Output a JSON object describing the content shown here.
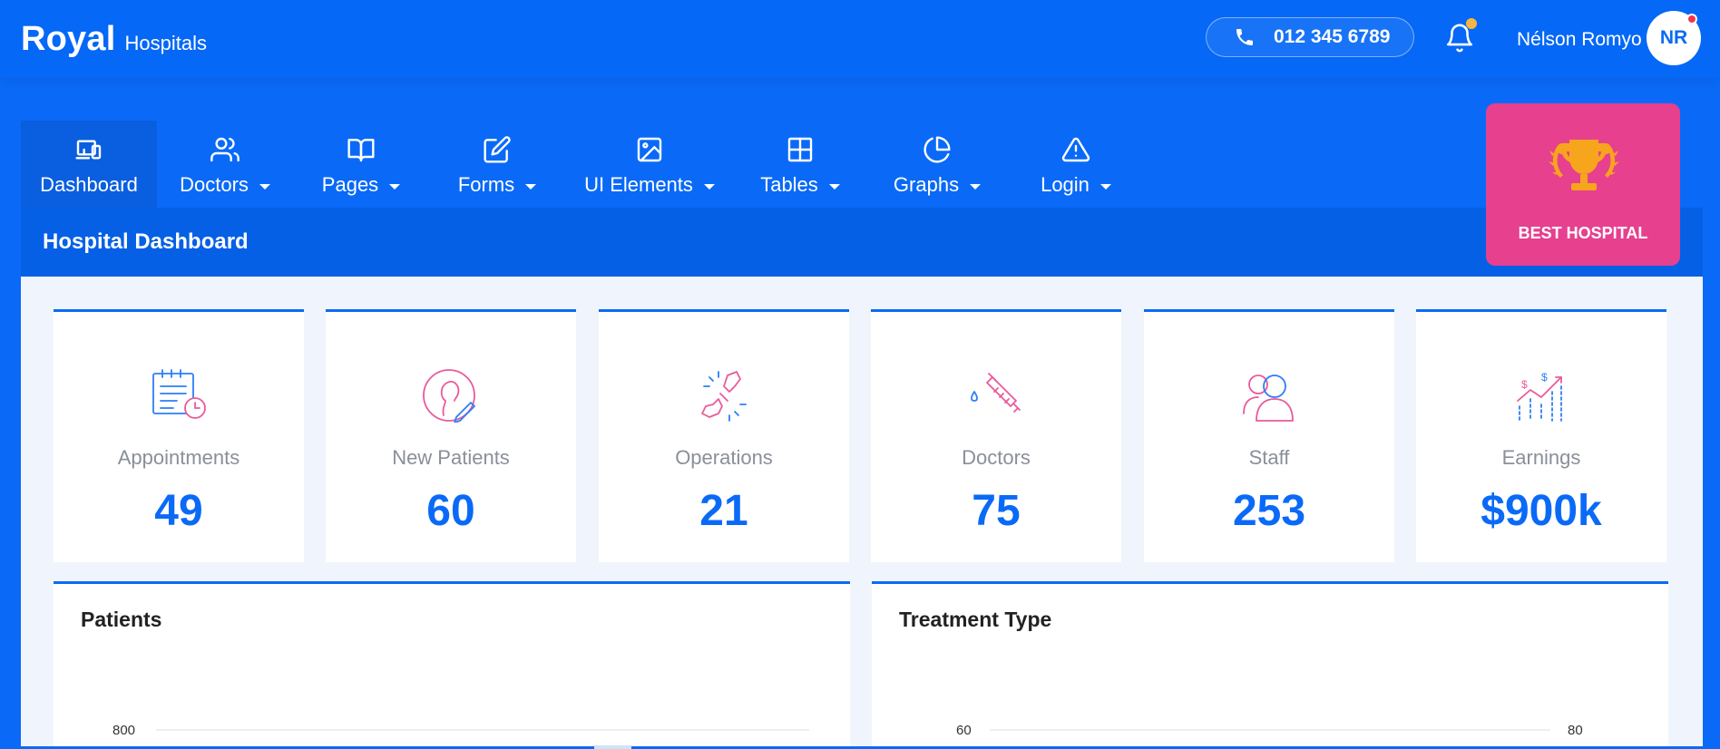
{
  "brand": {
    "name": "Royal",
    "suffix": "Hospitals"
  },
  "header": {
    "phone": "012 345 6789",
    "user_name": "Nélson Romyo",
    "avatar_initials": "NR"
  },
  "nav": [
    {
      "label": "Dashboard",
      "icon": "devices-icon",
      "active": true
    },
    {
      "label": "Doctors",
      "icon": "users-icon"
    },
    {
      "label": "Pages",
      "icon": "book-icon"
    },
    {
      "label": "Forms",
      "icon": "edit-icon"
    },
    {
      "label": "UI Elements",
      "icon": "image-icon"
    },
    {
      "label": "Tables",
      "icon": "grid-icon"
    },
    {
      "label": "Graphs",
      "icon": "pie-chart-icon"
    },
    {
      "label": "Login",
      "icon": "alert-triangle-icon"
    }
  ],
  "page_title": "Hospital Dashboard",
  "badge": {
    "label": "BEST HOSPITAL",
    "icon": "trophy-icon"
  },
  "stats": [
    {
      "label": "Appointments",
      "value": "49",
      "icon": "calendar-clock-icon"
    },
    {
      "label": "New Patients",
      "value": "60",
      "icon": "patient-icon"
    },
    {
      "label": "Operations",
      "value": "21",
      "icon": "bandage-icon"
    },
    {
      "label": "Doctors",
      "value": "75",
      "icon": "syringe-icon"
    },
    {
      "label": "Staff",
      "value": "253",
      "icon": "staff-icon"
    },
    {
      "label": "Earnings",
      "value": "$900k",
      "icon": "earnings-icon"
    }
  ],
  "charts": {
    "patients": {
      "title": "Patients",
      "tick_top": "800"
    },
    "treatment": {
      "title": "Treatment Type",
      "tick_left": "60",
      "tick_right": "80"
    }
  },
  "colors": {
    "primary": "#0a6af7",
    "badge": "#e6408f",
    "accent_pink": "#ea5a9a",
    "accent_blue": "#2d7ef7"
  }
}
